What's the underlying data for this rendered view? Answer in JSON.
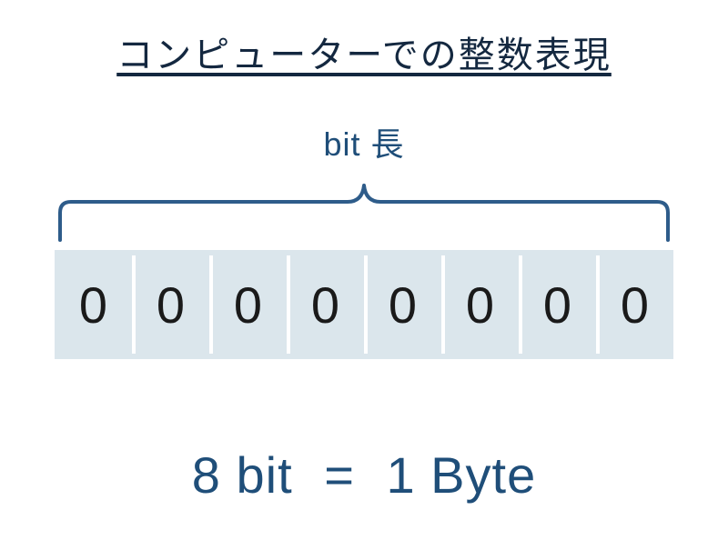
{
  "title": "コンピューターでの整数表現",
  "bit_length_label": "bit 長",
  "cells": [
    "0",
    "0",
    "0",
    "0",
    "0",
    "0",
    "0",
    "0"
  ],
  "equation": {
    "lhs": "8 bit",
    "eq": "=",
    "rhs": "1 Byte"
  },
  "colors": {
    "brace": "#2e5c8a",
    "cell_bg": "#dbe6ec",
    "text_dark": "#142840",
    "text_blue": "#1f4e79"
  }
}
